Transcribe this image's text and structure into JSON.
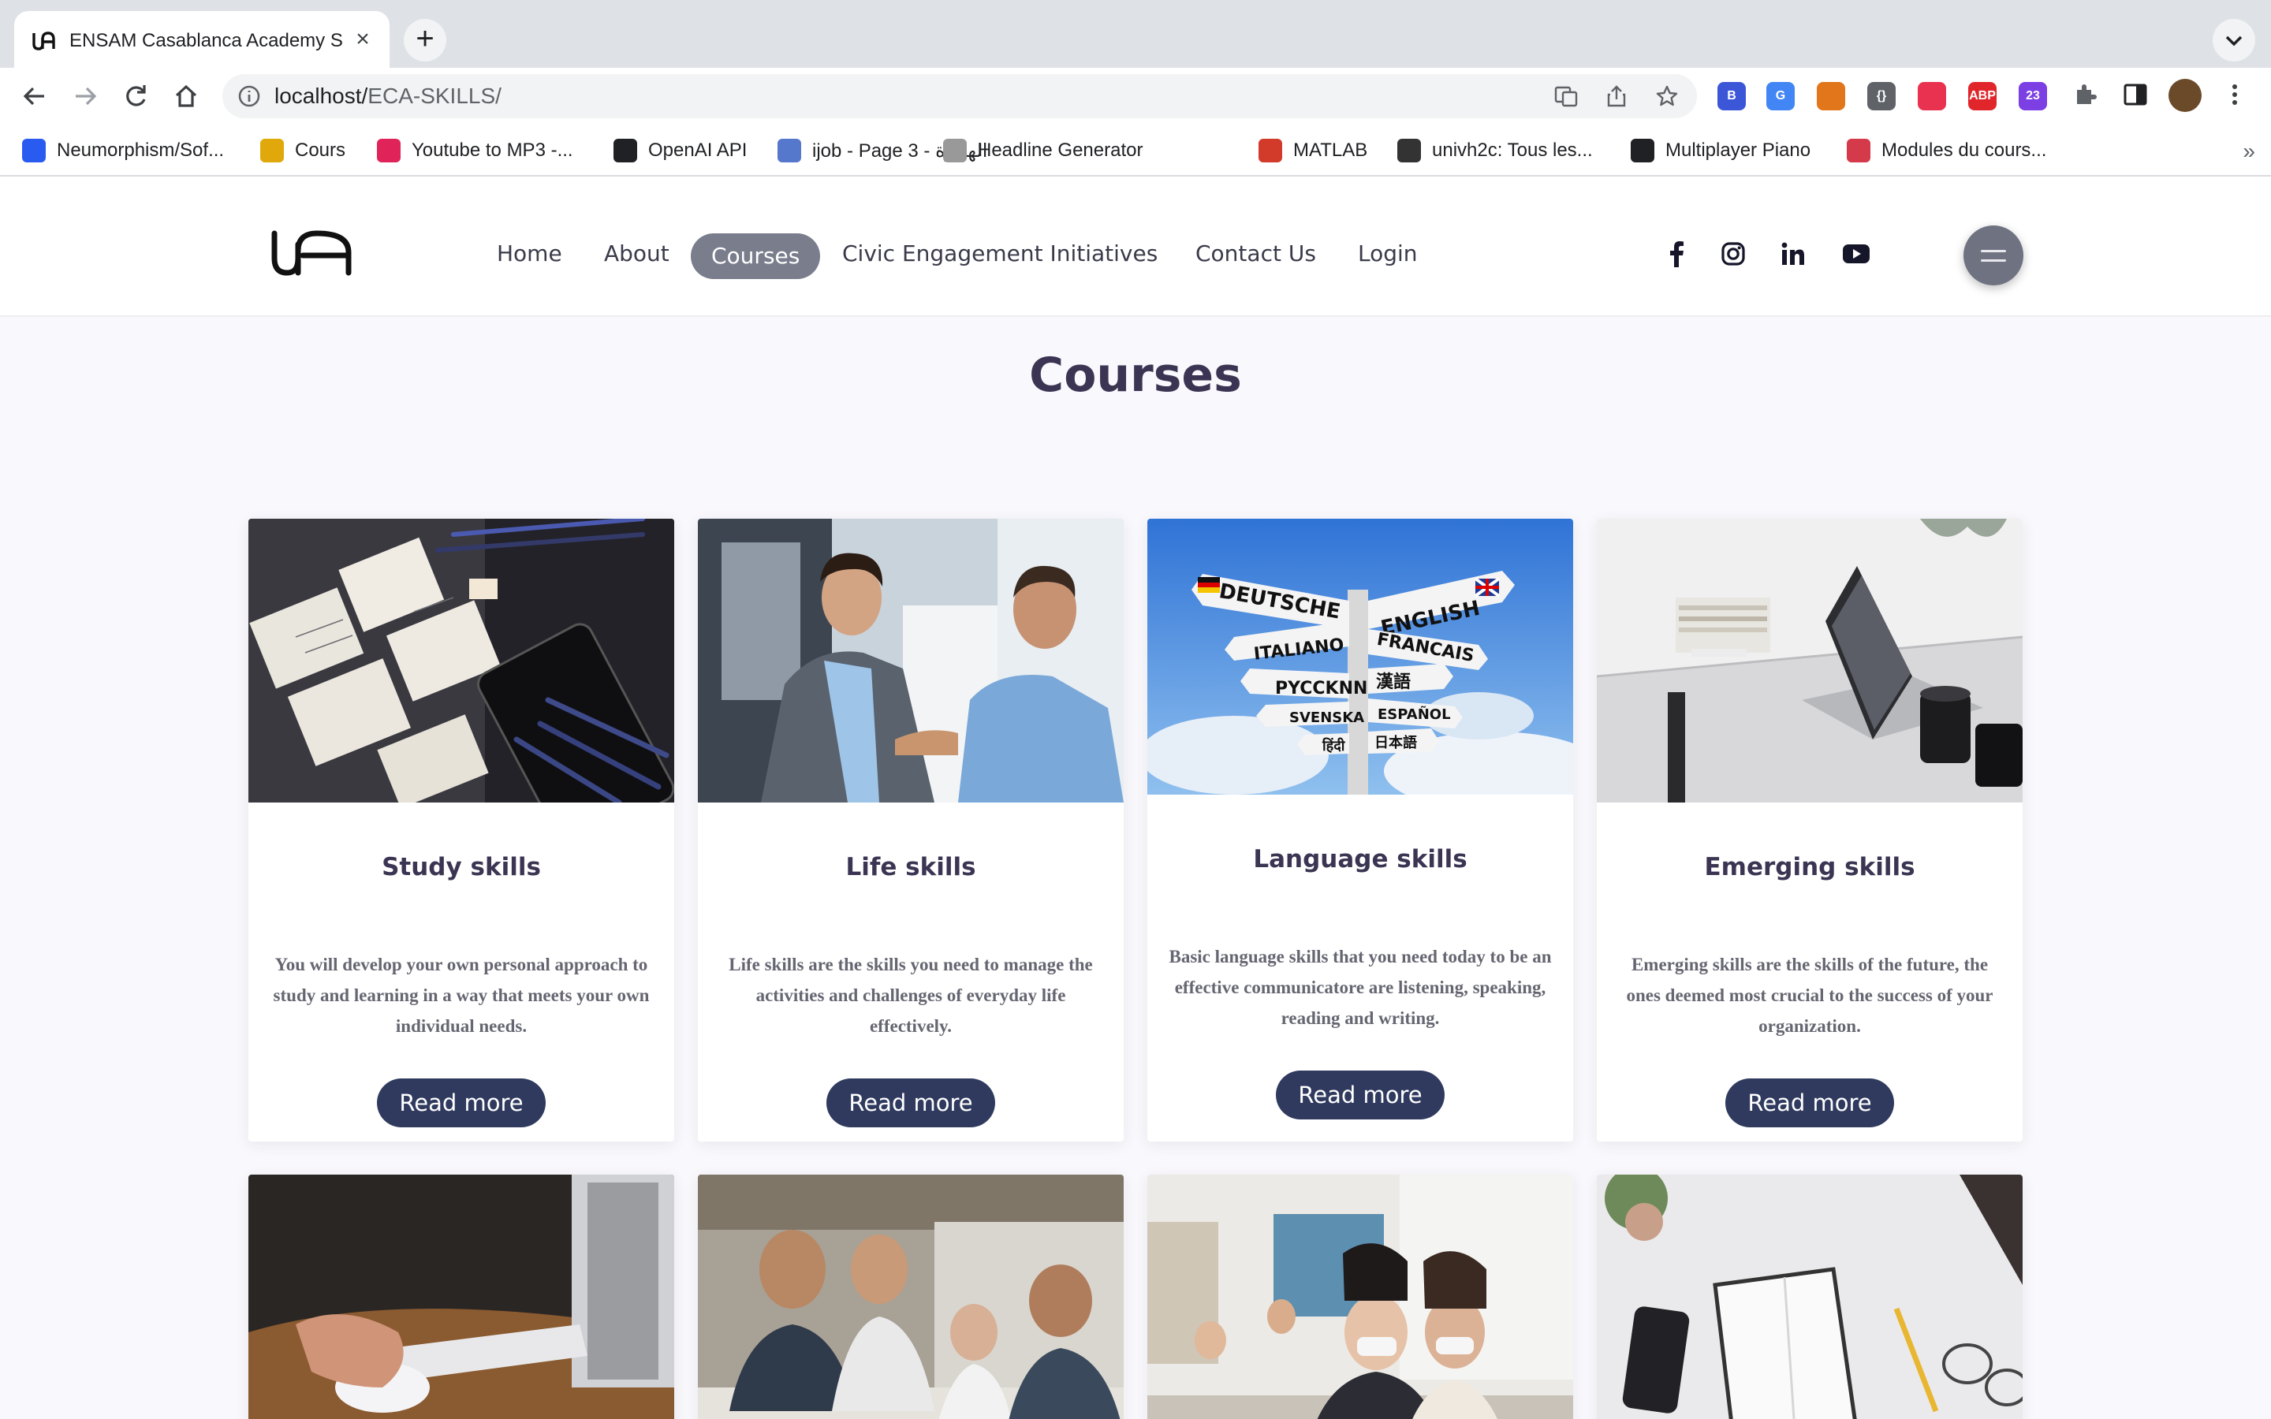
{
  "browser": {
    "tab_title": "ENSAM Casablanca Academy S",
    "tab_close": "×",
    "new_tab": "+",
    "url_host": "localhost/",
    "url_path": "ECA-SKILLS/",
    "extensions": [
      {
        "name": "b-extension",
        "label": "B",
        "color": "#3c56d8"
      },
      {
        "name": "google-translate-extension",
        "label": "G",
        "color": "#4285f4"
      },
      {
        "name": "metamask-extension",
        "label": "",
        "color": "#e2761b"
      },
      {
        "name": "json-extension",
        "label": "{}",
        "color": "#5f6368"
      },
      {
        "name": "red-extension",
        "label": "",
        "color": "#e9324f"
      },
      {
        "name": "adblock-plus-extension",
        "label": "ABP",
        "color": "#e0262a"
      },
      {
        "name": "s-extension",
        "label": "23",
        "color": "#7b3fe4"
      }
    ],
    "bookmarks": [
      {
        "label": "Neumorphism/Sof...",
        "color": "#2a5bf0"
      },
      {
        "label": "Cours",
        "color": "#e0a80a"
      },
      {
        "label": "Youtube to MP3 -...",
        "color": "#e0245a"
      },
      {
        "label": "OpenAI API",
        "color": "#202124"
      },
      {
        "label": "ijob - Page 3 - الهجرة",
        "color": "#5577cc"
      },
      {
        "label": "Headline Generator",
        "color": "#999999"
      },
      {
        "label": "MATLAB",
        "color": "#d23a2a"
      },
      {
        "label": "univh2c: Tous les...",
        "color": "#333333"
      },
      {
        "label": "Multiplayer Piano",
        "color": "#202124"
      },
      {
        "label": "Modules du cours...",
        "color": "#d43a4a"
      }
    ],
    "bookmarks_more": "»"
  },
  "header": {
    "menu": [
      "Home",
      "About",
      "Courses",
      "Civic Engagement Initiatives",
      "Contact Us",
      "Login"
    ],
    "active_menu": "Courses",
    "socials": [
      "facebook-icon",
      "instagram-icon",
      "linkedin-icon",
      "youtube-icon"
    ]
  },
  "main": {
    "title": "Courses",
    "cards": [
      {
        "title": "Study skills",
        "description": "You will develop your own personal approach to study and learning in a way that meets your own individual needs.",
        "button": "Read more",
        "image": "desk-with-notes-and-pencils"
      },
      {
        "title": "Life skills",
        "description": "Life skills are the skills you need to manage the activities and challenges of everyday life effectively.",
        "button": "Read more",
        "image": "business-handshake"
      },
      {
        "title": "Language skills",
        "description": "Basic language skills that you need today to be an effective communicatore are listening, speaking, reading and writing.",
        "button": "Read more",
        "image": "language-signpost"
      },
      {
        "title": "Emerging skills",
        "description": "Emerging skills are the skills of the future, the ones deemed most crucial to the success of your organization.",
        "button": "Read more",
        "image": "laptop-on-desk"
      }
    ],
    "signpost_labels": [
      "DEUTSCHE",
      "ENGLISH",
      "ITALIANO",
      "FRANCAIS",
      "PYCCKNN",
      "漢語",
      "SVENSKA",
      "ESPAÑOL",
      "हिंदी",
      "日本語"
    ]
  }
}
